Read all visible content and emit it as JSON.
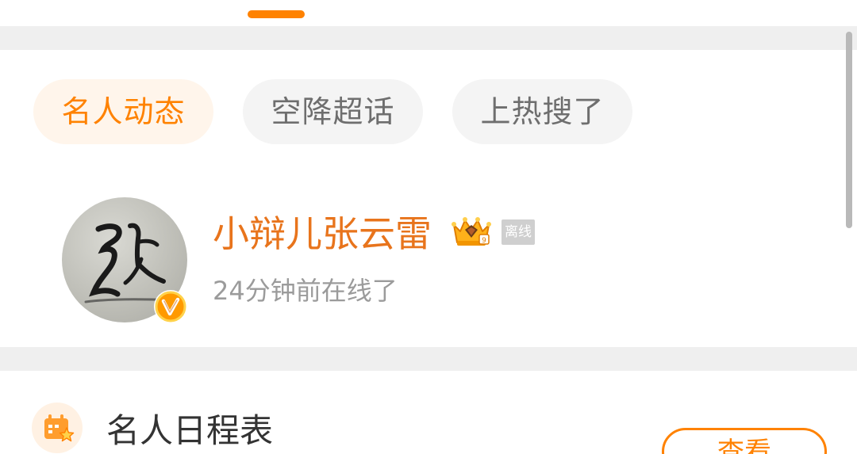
{
  "tabs": {
    "active_indicator_color": "#ff8200"
  },
  "chips": [
    {
      "label": "名人动态",
      "active": true
    },
    {
      "label": "空降超话",
      "active": false
    },
    {
      "label": "上热搜了",
      "active": false
    }
  ],
  "user": {
    "name": "小辩儿张云雷",
    "avatar_icon": "calligraphy-zhang-avatar",
    "verified_icon": "orange-v-verified-icon",
    "crown_icon": "crown-badge-icon",
    "status_tag": "离线",
    "online_text": "24分钟前在线了"
  },
  "schedule": {
    "icon": "calendar-star-icon",
    "title": "名人日程表",
    "button_label": "查看"
  },
  "colors": {
    "accent": "#ff8200",
    "name": "#e8741c",
    "muted": "#9b9b9b",
    "band": "#efefef"
  }
}
